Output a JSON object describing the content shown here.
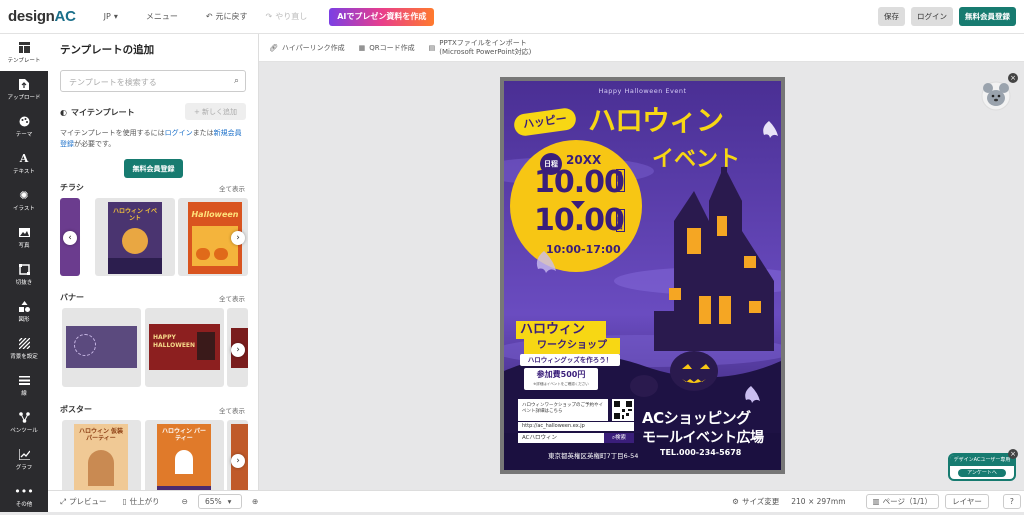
{
  "app": {
    "logo_main": "design",
    "logo_accent": "AC"
  },
  "topbar": {
    "language": "JP",
    "menu": "メニュー",
    "undo": "元に戻す",
    "redo": "やり直し",
    "ai_button": "AIでプレゼン資料を作成",
    "save": "保存",
    "login": "ログイン",
    "register": "無料会員登録"
  },
  "sidebar": {
    "items": [
      {
        "label": "テンプレート",
        "icon": "template-icon"
      },
      {
        "label": "アップロード",
        "icon": "upload-icon"
      },
      {
        "label": "テーマ",
        "icon": "palette-icon"
      },
      {
        "label": "テキスト",
        "icon": "text-icon"
      },
      {
        "label": "イラスト",
        "icon": "illustration-icon"
      },
      {
        "label": "写真",
        "icon": "photo-icon"
      },
      {
        "label": "切抜き",
        "icon": "crop-icon"
      },
      {
        "label": "図形",
        "icon": "shapes-icon"
      },
      {
        "label": "背景を設定",
        "icon": "background-icon"
      },
      {
        "label": "線",
        "icon": "line-icon"
      },
      {
        "label": "ペンツール",
        "icon": "pen-tool-icon"
      },
      {
        "label": "グラフ",
        "icon": "graph-icon"
      },
      {
        "label": "その他",
        "icon": "more-icon"
      }
    ]
  },
  "panel": {
    "title": "テンプレートの追加",
    "search_placeholder": "テンプレートを検索する",
    "my_templates": "マイテンプレート",
    "new_add": "新しく追加",
    "desc_1": "マイテンプレートを使用するには",
    "desc_login": "ログイン",
    "desc_2": "または",
    "desc_register": "新規会員登録",
    "desc_3": "が必要です。",
    "register_button": "無料会員登録",
    "sections": [
      {
        "title": "チラシ",
        "see_all": "全て表示"
      },
      {
        "title": "バナー",
        "see_all": "全て表示"
      },
      {
        "title": "ポスター",
        "see_all": "全て表示"
      }
    ],
    "flyer_thumbs": [
      {
        "title": "ハロウィン イベント",
        "color": "#e9a742"
      },
      {
        "title": "Halloween",
        "color": "#d9541f"
      }
    ],
    "banner_thumbs": [
      {
        "title": "",
        "color": "#5b4a7e"
      },
      {
        "title": "HAPPY HALLOWEEN",
        "color": "#8c1f1f"
      }
    ],
    "poster_thumbs": [
      {
        "title": "ハロウィン 仮装パーティー",
        "color": "#f0c995"
      },
      {
        "title": "ハロウィン パーティー",
        "color": "#e07a2a"
      }
    ]
  },
  "subbar": {
    "hyperlink": "ハイパーリンク作成",
    "qr": "QRコード作成",
    "pptx_1": "PPTXファイルをインポート",
    "pptx_2": "(Microsoft PowerPoint対応)"
  },
  "poster": {
    "event_en": "Happy Halloween Event",
    "happy": "ハッピー",
    "title_1": "ハロウィン",
    "title_2": "イベント",
    "day_tag": "日程",
    "year": "20XX",
    "date_1": "10.00",
    "date_2": "10.00",
    "weekday_1": "●曜日",
    "weekday_2": "●曜日",
    "time": "10:00-17:00",
    "workshop_1": "ハロウィン",
    "workshop_2": "ワークショップ",
    "goods": "ハロウィングッズを作ろう！",
    "fee": "参加費500円",
    "fee_note": "※詳細はイベントをご確認ください",
    "qr_text": "ハロウィンワークショップのご予約やイベント詳細はこちら",
    "url": "http://ac_halloween.ex.jp",
    "search_word": "ACハロウィン",
    "search_btn": "検索",
    "venue_1": "ACショッピング",
    "venue_2": "モールイベント広場",
    "address": "東京都英権区英権町7丁目6-54",
    "tel": "TEL.000-234-5678"
  },
  "bottombar": {
    "preview": "プレビュー",
    "finish": "仕上がり",
    "zoom": "65%",
    "size_change": "サイズ変更",
    "size": "210 × 297mm",
    "page": "ページ（1/1）",
    "layer": "レイヤー",
    "help": "?"
  },
  "survey": {
    "top": "デザインACユーザー専用",
    "button": "アンケートへ"
  }
}
